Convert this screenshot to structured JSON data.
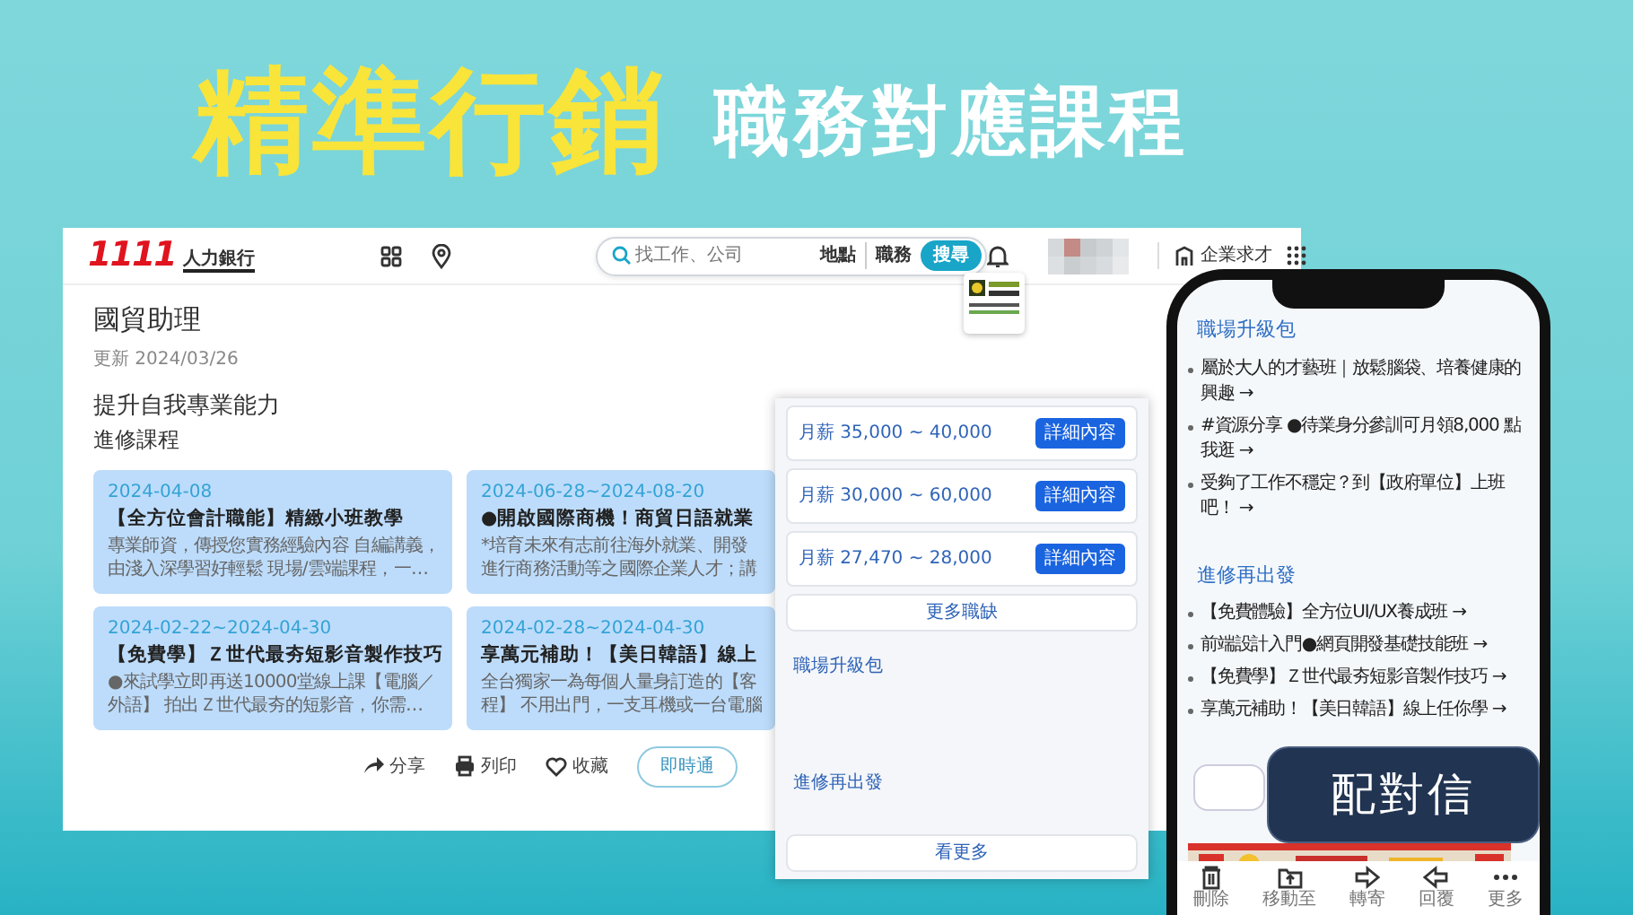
{
  "banner": {
    "headline": "精準行銷",
    "subheadline": "職務對應課程"
  },
  "site": {
    "logo_number": "1111",
    "logo_text": "人力銀行",
    "search": {
      "placeholder": "找工作、公司"
    },
    "search_options": [
      "地點",
      "職務"
    ],
    "search_button": "搜尋",
    "employer_link": "企業求才"
  },
  "page": {
    "title": "國貿助理",
    "updated": "更新 2024/03/26",
    "section_title": "提升自我專業能力",
    "section_subtitle": "進修課程",
    "courses": [
      {
        "date": "2024-04-08",
        "title": "【全方位會計職能】精緻小班教學",
        "description_lines": [
          "專業師資，傳授您實務經驗內容 自編講義，",
          "由淺入深學習好輕鬆 現場/雲端課程，一…"
        ]
      },
      {
        "date": "2024-06-28~2024-08-20",
        "title": "●開啟國際商機！商貿日語就業",
        "description_lines": [
          "*培育未來有志前往海外就業、開發",
          "進行商務活動等之國際企業人才；講"
        ]
      },
      {
        "date": "2024-02-22~2024-04-30",
        "title": "【免費學】Ｚ世代最夯短影音製作技巧",
        "description_lines": [
          "●來試學立即再送10000堂線上課【電腦／",
          "外語】 拍出Ｚ世代最夯的短影音，你需…"
        ]
      },
      {
        "date": "2024-02-28~2024-04-30",
        "title": "享萬元補助！【美日韓語】線上",
        "description_lines": [
          "全台獨家一為每個人量身訂造的【客",
          "程】 不用出門，一支耳機或一台電腦"
        ]
      }
    ],
    "actions": [
      "分享",
      "列印",
      "收藏"
    ],
    "chat_button": "即時通"
  },
  "side_panel": {
    "jobs": [
      {
        "salary": "月薪 35,000 ~ 40,000",
        "button": "詳細內容"
      },
      {
        "salary": "月薪 30,000 ~ 60,000",
        "button": "詳細內容"
      },
      {
        "salary": "月薪 27,470 ~ 28,000",
        "button": "詳細內容"
      }
    ],
    "more_jobs": "更多職缺",
    "headings": [
      "職場升級包",
      "進修再出發"
    ],
    "see_more": "看更多"
  },
  "phone": {
    "sections": [
      {
        "heading": "職場升級包",
        "items": [
          "屬於大人的才藝班｜放鬆腦袋、培養健康的興趣 →",
          "#資源分享 ●待業身分參訓可月領8,000 點我逛 →",
          "受夠了工作不穩定？到【政府單位】上班吧！ →"
        ]
      },
      {
        "heading": "進修再出發",
        "items": [
          "【免費體驗】全方位UI/UX養成班 →",
          "前端設計入門●網頁開發基礎技能班 →",
          "【免費學】Ｚ世代最夯短影音製作技巧 →",
          "享萬元補助！【美日韓語】線上任你學 →"
        ]
      }
    ],
    "toolbar": [
      {
        "kind": "trash",
        "label": "刪除"
      },
      {
        "kind": "move",
        "label": "移動至"
      },
      {
        "kind": "forward",
        "label": "轉寄"
      },
      {
        "kind": "reply",
        "label": "回覆"
      },
      {
        "kind": "more",
        "label": "更多"
      }
    ]
  },
  "bubble": "配對信"
}
